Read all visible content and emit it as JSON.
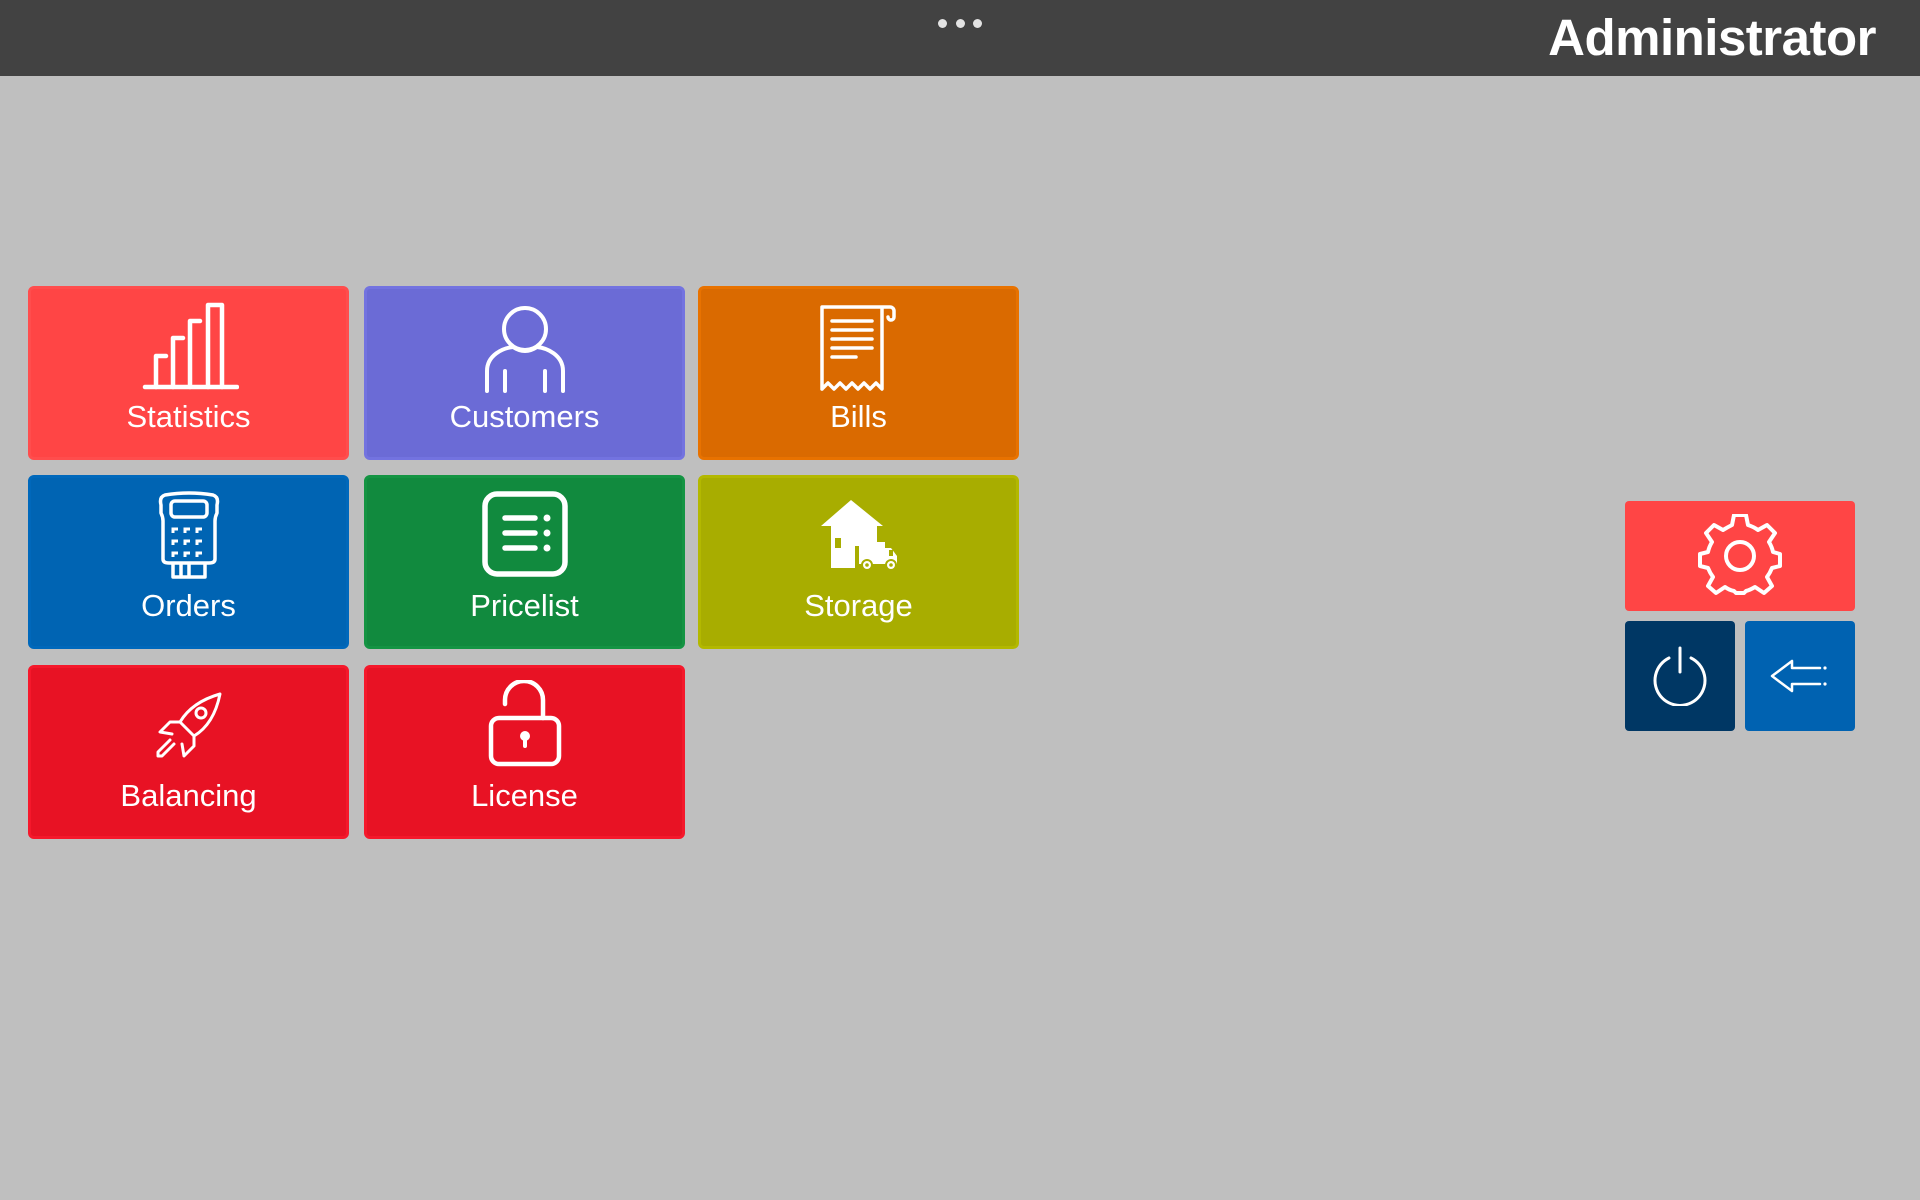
{
  "header": {
    "user_title": "Administrator",
    "menu_icon": "more-horizontal-icon"
  },
  "tiles": [
    {
      "label": "Statistics",
      "icon": "bar-chart-icon",
      "color": "#ff4545",
      "border": "#ff4d4d"
    },
    {
      "label": "Customers",
      "icon": "person-icon",
      "color": "#6b6bd6",
      "border": "#7373e0"
    },
    {
      "label": "Bills",
      "icon": "receipt-icon",
      "color": "#da6a00",
      "border": "#e87200"
    },
    {
      "label": "Orders",
      "icon": "payment-terminal-icon",
      "color": "#0064b3",
      "border": "#0068bb"
    },
    {
      "label": "Pricelist",
      "icon": "list-document-icon",
      "color": "#118a3e",
      "border": "#149443"
    },
    {
      "label": "Storage",
      "icon": "warehouse-truck-icon",
      "color": "#a8ad00",
      "border": "#b3b800"
    },
    {
      "label": "Balancing",
      "icon": "rocket-icon",
      "color": "#e81224",
      "border": "#f5182b"
    },
    {
      "label": "License",
      "icon": "unlock-icon",
      "color": "#e81224",
      "border": "#f5182b"
    }
  ],
  "actions": {
    "settings": {
      "icon": "gear-icon",
      "color": "#ff4545"
    },
    "power": {
      "icon": "power-icon",
      "color": "#003764"
    },
    "back": {
      "icon": "arrow-left-icon",
      "color": "#0062b1"
    }
  }
}
